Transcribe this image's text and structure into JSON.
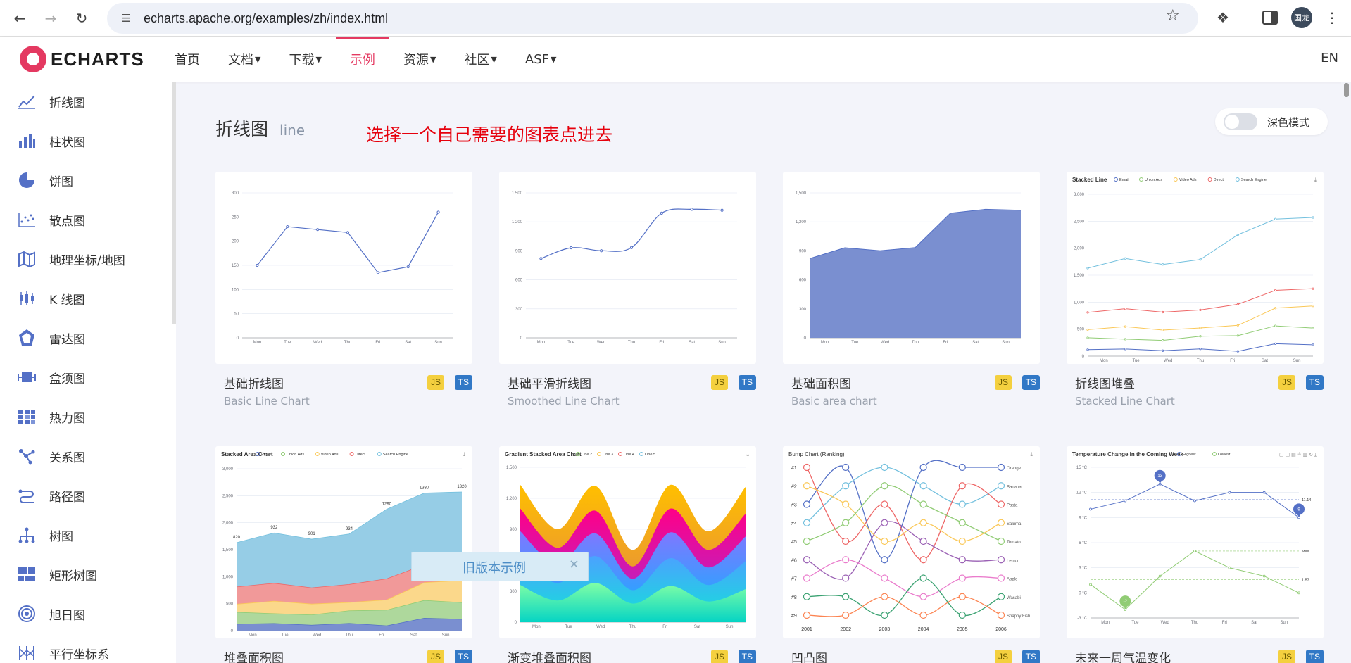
{
  "browser": {
    "url": "echarts.apache.org/examples/zh/index.html",
    "profile_label": "国龙"
  },
  "site": {
    "logo_text": "ECHARTS",
    "nav": [
      {
        "label": "首页"
      },
      {
        "label": "文档"
      },
      {
        "label": "下载"
      },
      {
        "label": "示例"
      },
      {
        "label": "资源"
      },
      {
        "label": "社区"
      },
      {
        "label": "ASF"
      }
    ],
    "lang": "EN"
  },
  "sidebar": {
    "items": [
      {
        "label": "折线图",
        "icon": "line-chart-icon"
      },
      {
        "label": "柱状图",
        "icon": "bar-chart-icon"
      },
      {
        "label": "饼图",
        "icon": "pie-chart-icon"
      },
      {
        "label": "散点图",
        "icon": "scatter-chart-icon"
      },
      {
        "label": "地理坐标/地图",
        "icon": "map-icon"
      },
      {
        "label": "K 线图",
        "icon": "candlestick-icon"
      },
      {
        "label": "雷达图",
        "icon": "radar-icon"
      },
      {
        "label": "盒须图",
        "icon": "boxplot-icon"
      },
      {
        "label": "热力图",
        "icon": "heatmap-icon"
      },
      {
        "label": "关系图",
        "icon": "graph-icon"
      },
      {
        "label": "路径图",
        "icon": "lines-icon"
      },
      {
        "label": "树图",
        "icon": "tree-icon"
      },
      {
        "label": "矩形树图",
        "icon": "treemap-icon"
      },
      {
        "label": "旭日图",
        "icon": "sunburst-icon"
      },
      {
        "label": "平行坐标系",
        "icon": "parallel-icon"
      }
    ]
  },
  "main": {
    "section_title": "折线图",
    "section_en": "line",
    "annotation": "选择一个自己需要的图表点进去",
    "dark_mode_label": "深色模式",
    "cards": [
      {
        "title": "基础折线图",
        "subtitle": "Basic Line Chart",
        "js": "JS",
        "ts": "TS"
      },
      {
        "title": "基础平滑折线图",
        "subtitle": "Smoothed Line Chart",
        "js": "JS",
        "ts": "TS"
      },
      {
        "title": "基础面积图",
        "subtitle": "Basic area chart",
        "js": "JS",
        "ts": "TS"
      },
      {
        "title": "折线图堆叠",
        "subtitle": "Stacked Line Chart",
        "js": "JS",
        "ts": "TS"
      },
      {
        "title": "堆叠面积图",
        "subtitle": "",
        "js": "JS",
        "ts": "TS"
      },
      {
        "title": "渐变堆叠面积图",
        "subtitle": "",
        "js": "JS",
        "ts": "TS"
      },
      {
        "title": "凹凸图",
        "subtitle": "",
        "js": "JS",
        "ts": "TS"
      },
      {
        "title": "未来一周气温变化",
        "subtitle": "",
        "js": "JS",
        "ts": "TS"
      }
    ],
    "toast": "旧版本示例",
    "toast_close": "×"
  },
  "chart_data": [
    {
      "type": "line",
      "categories": [
        "Mon",
        "Tue",
        "Wed",
        "Thu",
        "Fri",
        "Sat",
        "Sun"
      ],
      "values": [
        150,
        230,
        224,
        218,
        135,
        147,
        260
      ],
      "ylim": [
        0,
        300
      ],
      "yticks": [
        "0",
        "50",
        "100",
        "150",
        "200",
        "250",
        "300"
      ]
    },
    {
      "type": "line",
      "smooth": true,
      "categories": [
        "Mon",
        "Tue",
        "Wed",
        "Thu",
        "Fri",
        "Sat",
        "Sun"
      ],
      "values": [
        820,
        932,
        901,
        934,
        1290,
        1330,
        1320
      ],
      "ylim": [
        0,
        1500
      ],
      "yticks": [
        "0",
        "300",
        "600",
        "900",
        "1,200",
        "1,500"
      ]
    },
    {
      "type": "area",
      "categories": [
        "Mon",
        "Tue",
        "Wed",
        "Thu",
        "Fri",
        "Sat",
        "Sun"
      ],
      "values": [
        820,
        932,
        901,
        934,
        1290,
        1330,
        1320
      ],
      "ylim": [
        0,
        1500
      ],
      "yticks": [
        "0",
        "300",
        "600",
        "900",
        "1,200",
        "1,500"
      ]
    },
    {
      "type": "line",
      "title": "Stacked Line",
      "categories": [
        "Mon",
        "Tue",
        "Wed",
        "Thu",
        "Fri",
        "Sat",
        "Sun"
      ],
      "ylim": [
        0,
        3000
      ],
      "yticks": [
        "0",
        "500",
        "1,000",
        "1,500",
        "2,000",
        "2,500",
        "3,000"
      ],
      "series": [
        {
          "name": "Email",
          "values": [
            120,
            132,
            101,
            134,
            90,
            230,
            210
          ]
        },
        {
          "name": "Union Ads",
          "values": [
            340,
            314,
            292,
            368,
            380,
            560,
            520
          ]
        },
        {
          "name": "Video Ads",
          "values": [
            490,
            546,
            483,
            522,
            570,
            890,
            930
          ]
        },
        {
          "name": "Direct",
          "values": [
            810,
            878,
            815,
            856,
            960,
            1220,
            1250
          ]
        },
        {
          "name": "Search Engine",
          "values": [
            1630,
            1810,
            1699,
            1790,
            2250,
            2540,
            2570
          ]
        }
      ]
    },
    {
      "type": "area",
      "title": "Stacked Area Chart",
      "categories": [
        "Mon",
        "Tue",
        "Wed",
        "Thu",
        "Fri",
        "Sat",
        "Sun"
      ],
      "ylim": [
        0,
        3000
      ],
      "yticks": [
        "0",
        "500",
        "1,000",
        "1,500",
        "2,000",
        "2,500",
        "3,000"
      ],
      "top_labels": [
        "820",
        "932",
        "901",
        "934",
        "1290",
        "1330",
        "1320"
      ],
      "series": [
        {
          "name": "Email",
          "values": [
            120,
            132,
            101,
            134,
            90,
            230,
            210
          ]
        },
        {
          "name": "Union Ads",
          "values": [
            220,
            182,
            191,
            234,
            290,
            330,
            310
          ]
        },
        {
          "name": "Video Ads",
          "values": [
            150,
            232,
            201,
            154,
            190,
            330,
            410
          ]
        },
        {
          "name": "Direct",
          "values": [
            320,
            332,
            301,
            334,
            390,
            330,
            320
          ]
        },
        {
          "name": "Search Engine",
          "values": [
            820,
            932,
            901,
            934,
            1290,
            1330,
            1320
          ]
        }
      ]
    },
    {
      "type": "area",
      "title": "Gradient Stacked Area Chart",
      "categories": [
        "Mon",
        "Tue",
        "Wed",
        "Thu",
        "Fri",
        "Sat",
        "Sun"
      ],
      "ylim": [
        0,
        1500
      ],
      "yticks": [
        "0",
        "300",
        "600",
        "900",
        "1,200",
        "1,500"
      ],
      "legend": [
        "Line 2",
        "Line 3",
        "Line 4",
        "Line 5"
      ]
    },
    {
      "type": "line",
      "title": "Bump Chart (Ranking)",
      "categories": [
        "2001",
        "2002",
        "2003",
        "2004",
        "2005",
        "2006"
      ],
      "ranks": [
        "#1",
        "#2",
        "#3",
        "#4",
        "#5",
        "#6",
        "#7",
        "#8",
        "#9"
      ],
      "series_labels": [
        "Orange",
        "Banana",
        "Pasta",
        "Saluma",
        "Tomato",
        "Lemon",
        "Apple",
        "Wasabi",
        "Snappy Fish"
      ]
    },
    {
      "type": "line",
      "title": "Temperature Change in the Coming Week",
      "categories": [
        "Mon",
        "Tue",
        "Wed",
        "Thu",
        "Fri",
        "Sat",
        "Sun"
      ],
      "ylim": [
        -3,
        15
      ],
      "yticks": [
        "-3 °C",
        "0 °C",
        "3 °C",
        "6 °C",
        "9 °C",
        "12 °C",
        "15 °C"
      ],
      "legend": [
        "Highest",
        "Lowest"
      ],
      "series": [
        {
          "name": "Highest",
          "values": [
            10,
            11,
            13,
            11,
            12,
            12,
            9
          ]
        },
        {
          "name": "Lowest",
          "values": [
            1,
            -2,
            2,
            5,
            3,
            2,
            0
          ]
        }
      ],
      "marks": [
        "13",
        "9",
        "11.14",
        "Max",
        "1.57",
        "-2"
      ]
    }
  ]
}
